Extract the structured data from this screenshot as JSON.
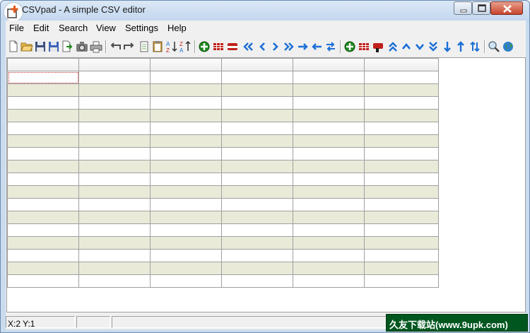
{
  "window": {
    "title": "CSVpad - A simple CSV editor"
  },
  "menu": {
    "items": [
      "File",
      "Edit",
      "Search",
      "View",
      "Settings",
      "Help"
    ]
  },
  "toolbar": {
    "icons": [
      "new-file-icon",
      "open-folder-icon",
      "save-icon",
      "save-as-icon",
      "export-icon",
      "screenshot-icon",
      "print-icon",
      "undo-icon",
      "redo-icon",
      "copy-icon",
      "paste-icon",
      "sort-ascending-icon",
      "sort-descending-icon",
      "add-row-icon",
      "insert-row-icon",
      "delete-row-icon",
      "move-first-icon",
      "move-prev-icon",
      "move-next-icon",
      "move-last-icon",
      "shift-right-icon",
      "shift-left-icon",
      "swap-icon",
      "add-column-icon",
      "insert-column-icon",
      "delete-column-icon",
      "move-top-icon",
      "move-up-icon",
      "move-down-icon",
      "move-bottom-icon",
      "arrow-down-icon",
      "arrow-up-icon",
      "swap-vertical-icon",
      "search-icon",
      "web-globe-icon"
    ],
    "colors": {
      "blue_arrow": "#1c6fd6",
      "green_plus": "#1f8a1f",
      "red_table": "#c0201c"
    }
  },
  "grid": {
    "columns": 6,
    "rows": 17,
    "selected_cell": "row-1-col-1",
    "band_color": "#eaead9"
  },
  "status": {
    "position": "X:2  Y:1"
  },
  "watermark": {
    "text": "久友下载站(www.9upk.com)"
  }
}
